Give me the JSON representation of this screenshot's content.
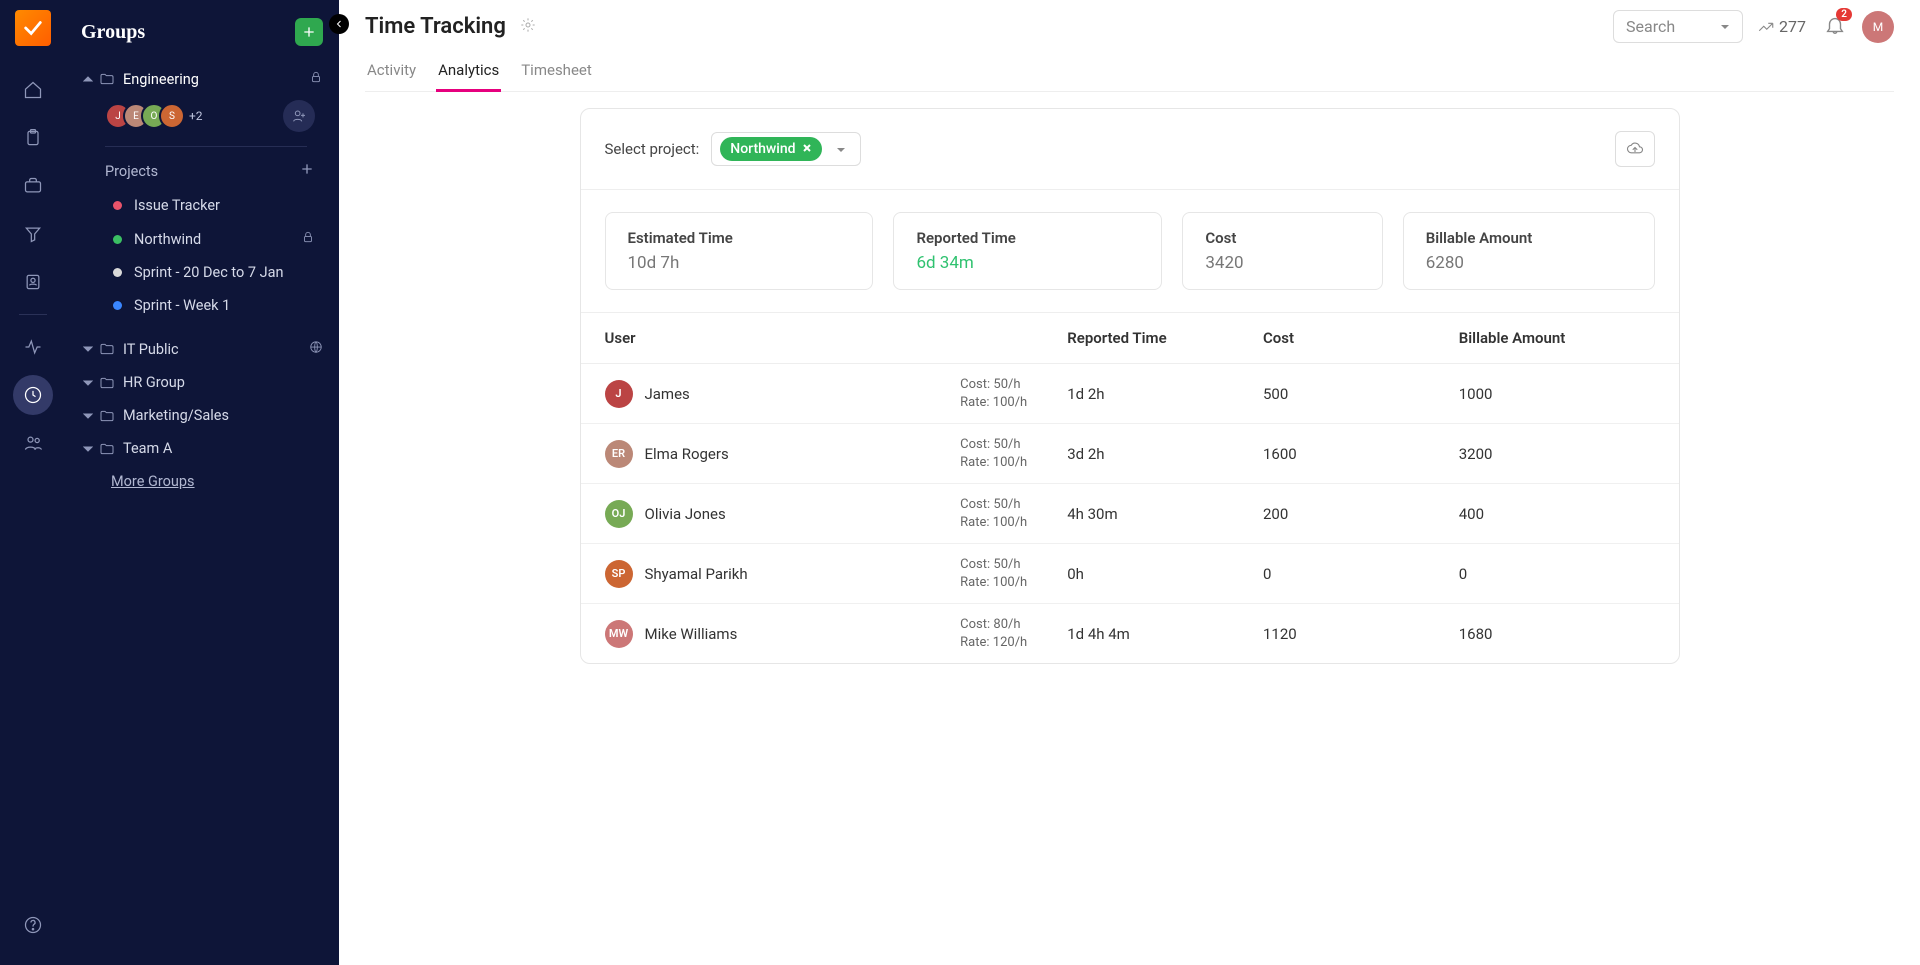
{
  "sidebar": {
    "title": "Groups",
    "engineering": {
      "label": "Engineering"
    },
    "avatars_more": "+2",
    "projects_label": "Projects",
    "projects": [
      {
        "label": "Issue Tracker",
        "dot": "#e9546b",
        "locked": false
      },
      {
        "label": "Northwind",
        "dot": "#3bbf63",
        "locked": true
      },
      {
        "label": "Sprint - 20 Dec to 7 Jan",
        "dot": "#d9d9d9",
        "locked": false
      },
      {
        "label": "Sprint - Week 1",
        "dot": "#3a86ff",
        "locked": false
      }
    ],
    "groups": [
      {
        "label": "IT Public",
        "globe": true
      },
      {
        "label": "HR Group"
      },
      {
        "label": "Marketing/Sales"
      },
      {
        "label": "Team A"
      }
    ],
    "more_groups": "More Groups"
  },
  "header": {
    "title": "Time Tracking",
    "tabs": {
      "activity": "Activity",
      "analytics": "Analytics",
      "timesheet": "Timesheet"
    },
    "search_label": "Search",
    "trend": "277",
    "notif_badge": "2"
  },
  "filter": {
    "label": "Select project:",
    "chip": "Northwind"
  },
  "cards": {
    "est": {
      "label": "Estimated Time",
      "value": "10d 7h"
    },
    "rep": {
      "label": "Reported Time",
      "value": "6d 34m"
    },
    "cost": {
      "label": "Cost",
      "value": "3420"
    },
    "bill": {
      "label": "Billable Amount",
      "value": "6280"
    }
  },
  "table": {
    "headers": {
      "user": "User",
      "reported": "Reported Time",
      "cost": "Cost",
      "billable": "Billable Amount"
    },
    "rows": [
      {
        "name": "James",
        "cost_label": "Cost: 50/h",
        "rate_label": "Rate: 100/h",
        "reported": "1d 2h",
        "cost": "500",
        "billable": "1000",
        "color": "#b44"
      },
      {
        "name": "Elma Rogers",
        "cost_label": "Cost: 50/h",
        "rate_label": "Rate: 100/h",
        "reported": "3d 2h",
        "cost": "1600",
        "billable": "3200",
        "color": "#b87"
      },
      {
        "name": "Olivia Jones",
        "cost_label": "Cost: 50/h",
        "rate_label": "Rate: 100/h",
        "reported": "4h 30m",
        "cost": "200",
        "billable": "400",
        "color": "#7a5"
      },
      {
        "name": "Shyamal Parikh",
        "cost_label": "Cost: 50/h",
        "rate_label": "Rate: 100/h",
        "reported": "0h",
        "cost": "0",
        "billable": "0",
        "color": "#c63"
      },
      {
        "name": "Mike Williams",
        "cost_label": "Cost: 80/h",
        "rate_label": "Rate: 120/h",
        "reported": "1d 4h 4m",
        "cost": "1120",
        "billable": "1680",
        "color": "#c77"
      }
    ]
  }
}
